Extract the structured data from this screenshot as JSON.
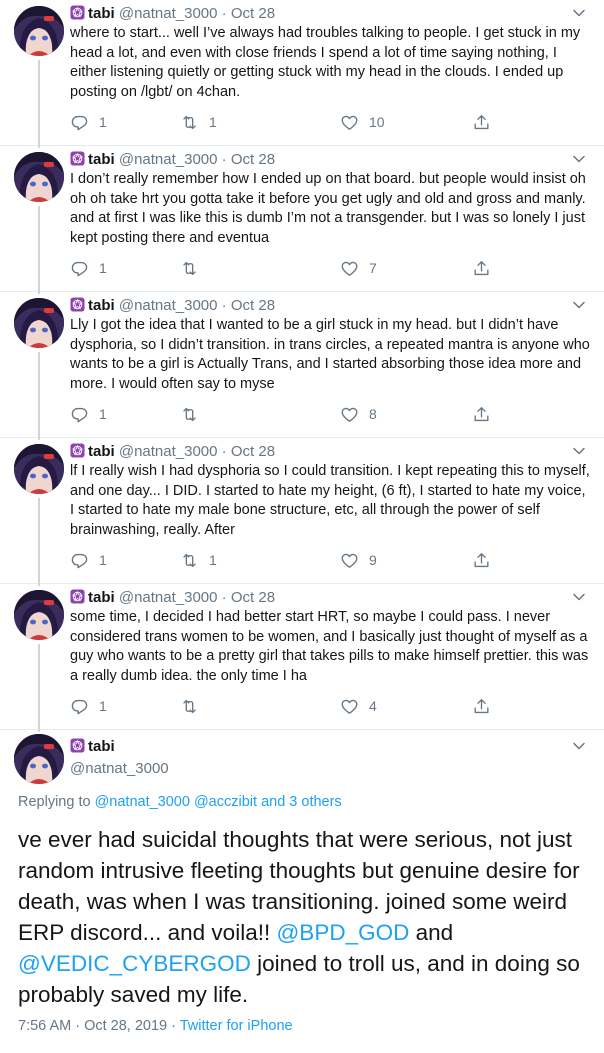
{
  "colors": {
    "accent": "#1da1f2",
    "muted": "#657786",
    "text": "#14171a",
    "badge": "#8e44ad"
  },
  "author": {
    "display_name": "tabi",
    "handle": "@natnat_3000"
  },
  "tweets": [
    {
      "date": "Oct 28",
      "text": "where to start... well I’ve always had troubles talking to people. I get stuck in my head a lot, and even with close friends I spend a lot of time saying nothing, I either listening quietly or getting stuck with my head in the clouds. I ended up posting on /lgbt/ on 4chan.",
      "replies": "1",
      "retweets": "1",
      "likes": "10"
    },
    {
      "date": "Oct 28",
      "text": "I don’t really remember how I ended up on that board. but people would insist oh oh oh take hrt you gotta take it before you get ugly and old and gross and manly. and at first I was like this is dumb I’m not a transgender. but I was so lonely I just kept posting there and eventua",
      "replies": "1",
      "retweets": "",
      "likes": "7"
    },
    {
      "date": "Oct 28",
      "text": "Lly I got the idea that I wanted to be a girl stuck in my head. but I didn’t have dysphoria, so I didn’t transition. in trans circles, a repeated mantra is anyone who wants to be a girl is Actually Trans, and I started absorbing those idea more and more. I would often say to myse",
      "replies": "1",
      "retweets": "",
      "likes": "8"
    },
    {
      "date": "Oct 28",
      "text": "lf I really wish I had dysphoria so I could transition. I kept repeating this to myself, and one day... I DID. I started to hate my height, (6 ft), I started to hate my voice, I started to hate my male bone structure, etc, all through the power of self brainwashing, really. After",
      "replies": "1",
      "retweets": "1",
      "likes": "9"
    },
    {
      "date": "Oct 28",
      "text": "some time, I decided I had better start HRT, so maybe I could pass. I never considered trans women to be women, and I basically just thought of myself as a guy who wants to be a pretty girl that takes pills to make himself prettier. this was a really dumb idea. the only time I ha",
      "replies": "1",
      "retweets": "",
      "likes": "4"
    }
  ],
  "main_tweet": {
    "replying_prefix": "Replying to",
    "replying_users": "@natnat_3000 @acczibit",
    "replying_more": "and 3 others",
    "text_part1": "ve ever had suicidal thoughts that were serious, not just random intrusive fleeting thoughts but genuine desire for death, was when I was transitioning. joined some weird ERP discord... and voila!! ",
    "mention1": "@BPD_GOD",
    "text_part2": " and ",
    "mention2": "@VEDIC_CYBERGOD",
    "text_part3": " joined to troll us, and in doing so probably saved my life.",
    "timestamp": "7:56 AM · Oct 28, 2019 · ",
    "source": "Twitter for iPhone"
  },
  "icons": {
    "reply": "reply-icon",
    "retweet": "retweet-icon",
    "like": "heart-icon",
    "share": "share-icon",
    "caret": "chevron-down-icon",
    "badge": "star-badge-icon"
  }
}
